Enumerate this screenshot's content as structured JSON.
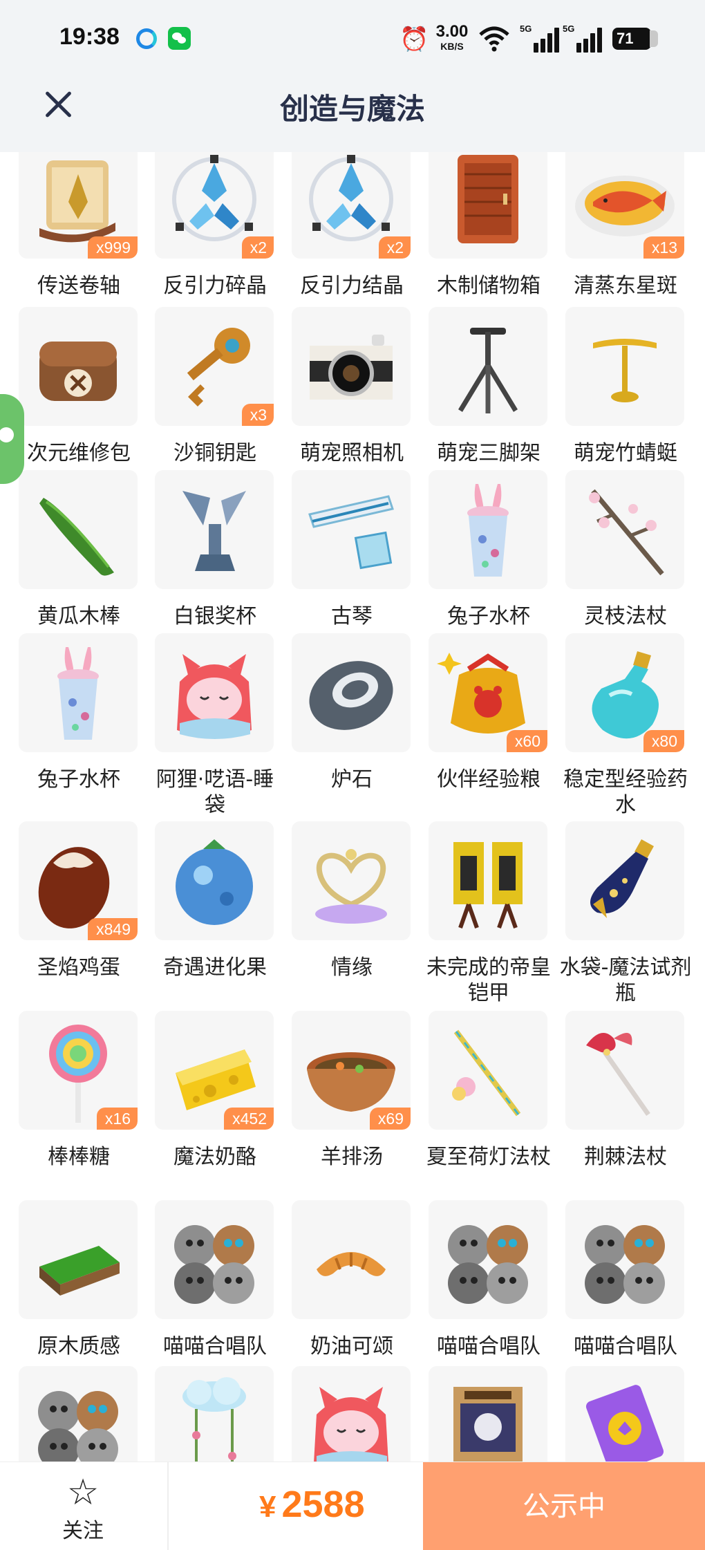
{
  "status_bar": {
    "time": "19:38",
    "net_speed_value": "3.00",
    "net_speed_unit": "KB/S",
    "signal1_tag": "5G",
    "signal2_tag": "5G",
    "battery": "71"
  },
  "header": {
    "title": "创造与魔法",
    "close_icon": "close-icon"
  },
  "items": [
    {
      "label": "传送卷轴",
      "badge": "x999",
      "icon": "scroll"
    },
    {
      "label": "反引力碎晶",
      "badge": "x2",
      "icon": "crystal"
    },
    {
      "label": "反引力结晶",
      "badge": "x2",
      "icon": "crystal"
    },
    {
      "label": "木制储物箱",
      "badge": "",
      "icon": "wood-cabinet"
    },
    {
      "label": "清蒸东星斑",
      "badge": "x13",
      "icon": "fish-dish"
    },
    {
      "label": "次元维修包",
      "badge": "",
      "icon": "repair-bag"
    },
    {
      "label": "沙铜钥匙",
      "badge": "x3",
      "icon": "key"
    },
    {
      "label": "萌宠照相机",
      "badge": "",
      "icon": "camera"
    },
    {
      "label": "萌宠三脚架",
      "badge": "",
      "icon": "tripod"
    },
    {
      "label": "萌宠竹蜻蜓",
      "badge": "",
      "icon": "bamboo-copter"
    },
    {
      "label": "黄瓜木棒",
      "badge": "",
      "icon": "cucumber"
    },
    {
      "label": "白银奖杯",
      "badge": "",
      "icon": "trophy"
    },
    {
      "label": "古琴",
      "badge": "",
      "icon": "guqin"
    },
    {
      "label": "兔子水杯",
      "badge": "",
      "icon": "bunny-cup"
    },
    {
      "label": "灵枝法杖",
      "badge": "",
      "icon": "branch-staff"
    },
    {
      "label": "兔子水杯",
      "badge": "",
      "icon": "bunny-cup"
    },
    {
      "label": "阿狸·呓语-睡袋",
      "badge": "",
      "icon": "ali-sleeping-bag"
    },
    {
      "label": "炉石",
      "badge": "",
      "icon": "hearthstone"
    },
    {
      "label": "伙伴经验粮",
      "badge": "x60",
      "icon": "food-bag"
    },
    {
      "label": "稳定型经验药水",
      "badge": "x80",
      "icon": "potion"
    },
    {
      "label": "圣焰鸡蛋",
      "badge": "x849",
      "icon": "egg"
    },
    {
      "label": "奇遇进化果",
      "badge": "",
      "icon": "blue-fruit"
    },
    {
      "label": "情缘",
      "badge": "",
      "icon": "heart-ornament"
    },
    {
      "label": "未完成的帝皇铠甲",
      "badge": "",
      "icon": "armor"
    },
    {
      "label": "水袋-魔法试剂瓶",
      "badge": "",
      "icon": "magic-flask"
    },
    {
      "label": "棒棒糖",
      "badge": "x16",
      "icon": "lollipop"
    },
    {
      "label": "魔法奶酪",
      "badge": "x452",
      "icon": "cheese"
    },
    {
      "label": "羊排汤",
      "badge": "x69",
      "icon": "soup"
    },
    {
      "label": "夏至荷灯法杖",
      "badge": "",
      "icon": "lotus-staff"
    },
    {
      "label": "荆棘法杖",
      "badge": "",
      "icon": "thorn-staff"
    },
    {
      "label": "原木质感",
      "badge": "",
      "icon": "grass-tile"
    },
    {
      "label": "喵喵合唱队",
      "badge": "",
      "icon": "cat-choir"
    },
    {
      "label": "奶油可颂",
      "badge": "",
      "icon": "croissant"
    },
    {
      "label": "喵喵合唱队",
      "badge": "",
      "icon": "cat-choir"
    },
    {
      "label": "喵喵合唱队",
      "badge": "",
      "icon": "cat-choir"
    },
    {
      "label": "",
      "badge": "",
      "icon": "cat-choir"
    },
    {
      "label": "",
      "badge": "",
      "icon": "cloud-lamp"
    },
    {
      "label": "",
      "badge": "",
      "icon": "ali-sleeping-bag"
    },
    {
      "label": "",
      "badge": "",
      "icon": "wanted-poster"
    },
    {
      "label": "",
      "badge": "",
      "icon": "purple-card"
    }
  ],
  "bottom_bar": {
    "follow_label": "关注",
    "currency": "¥",
    "price": "2588",
    "publicity_button": "公示中"
  },
  "colors": {
    "accent": "#ff7a1a",
    "badge": "#ff8f4a",
    "publicity_button": "#ffa070",
    "title": "#28304a"
  }
}
